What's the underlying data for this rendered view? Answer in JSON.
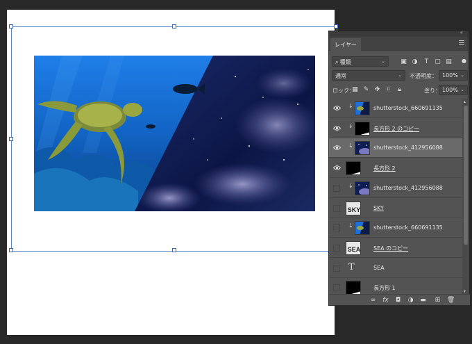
{
  "panel": {
    "tab_label": "レイヤー",
    "collapse_glyph": "«",
    "filter": {
      "selected": "種類"
    },
    "blend_mode": "通常",
    "opacity_label": "不透明度：",
    "opacity_value": "100%",
    "lock_label": "ロック：",
    "fill_label": "塗り：",
    "fill_value": "100%"
  },
  "layers": [
    {
      "name": "shutterstock_660691135",
      "visible": true,
      "clipped": true,
      "thumb": "ocean",
      "underline": false,
      "selected": false
    },
    {
      "name": "長方形 2 のコピー",
      "visible": true,
      "clipped": true,
      "thumb": "shape",
      "underline": true,
      "selected": false
    },
    {
      "name": "shutterstock_412956088",
      "visible": true,
      "clipped": true,
      "thumb": "space",
      "underline": false,
      "selected": true
    },
    {
      "name": "長方形 2",
      "visible": true,
      "clipped": false,
      "thumb": "shape",
      "underline": true,
      "selected": false
    },
    {
      "name": "shutterstock_412956088",
      "visible": false,
      "clipped": true,
      "thumb": "space",
      "underline": false,
      "selected": false
    },
    {
      "name": "SKY",
      "visible": false,
      "clipped": false,
      "thumb": "sky",
      "underline": true,
      "selected": false
    },
    {
      "name": "shutterstock_660691135",
      "visible": false,
      "clipped": true,
      "thumb": "ocean",
      "underline": false,
      "selected": false
    },
    {
      "name": "SEA のコピー",
      "visible": false,
      "clipped": false,
      "thumb": "sea",
      "underline": true,
      "selected": false
    },
    {
      "name": "SEA",
      "visible": false,
      "clipped": false,
      "thumb": "text",
      "underline": false,
      "selected": false
    },
    {
      "name": "長方形 1",
      "visible": false,
      "clipped": false,
      "thumb": "shape",
      "underline": false,
      "selected": false
    }
  ],
  "thumb_text": {
    "sky": "SKY",
    "sea": "SEA",
    "type": "T"
  },
  "colors": {
    "panel_bg": "#535353",
    "selection": "#5d86c7",
    "selected_row": "#6a6a6a"
  }
}
